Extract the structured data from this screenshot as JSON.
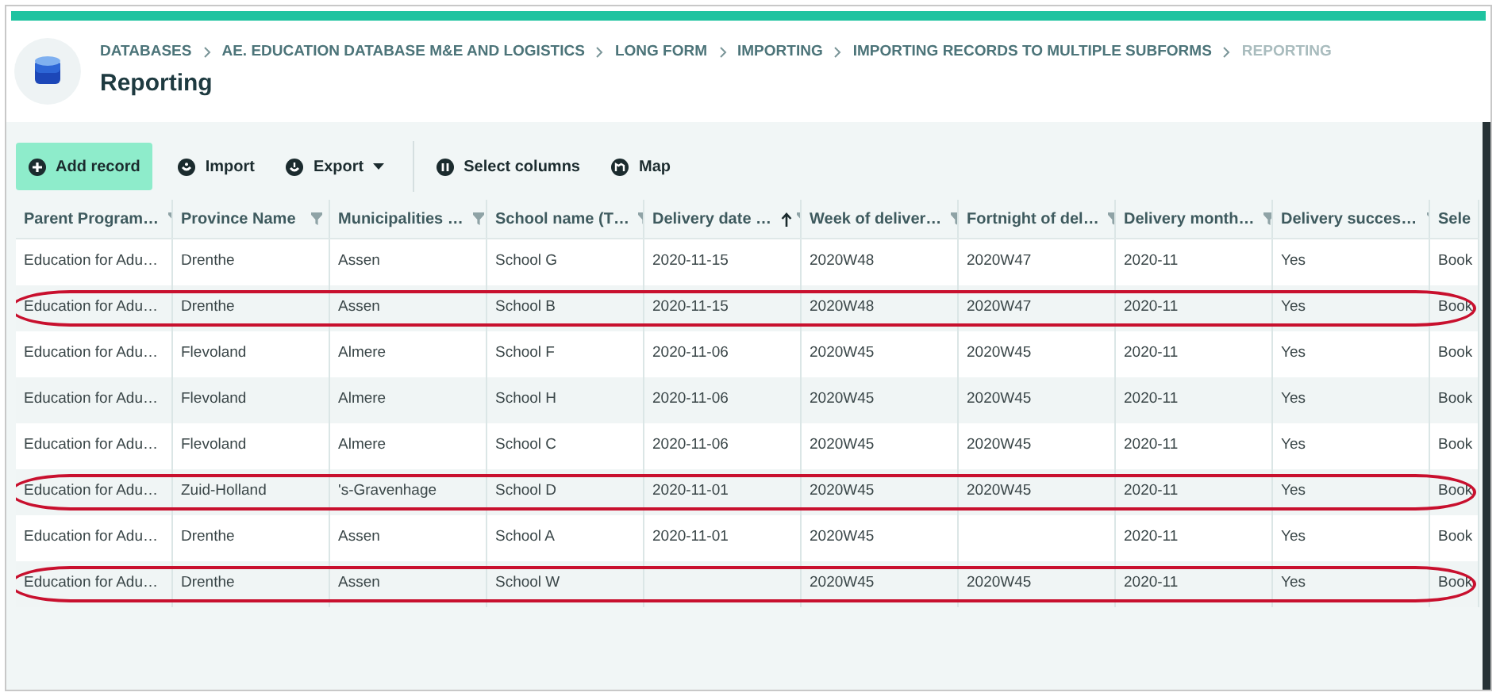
{
  "breadcrumbs": [
    {
      "label": "DATABASES",
      "current": false
    },
    {
      "label": "AE. EDUCATION DATABASE M&E AND LOGISTICS",
      "current": false
    },
    {
      "label": "LONG FORM",
      "current": false
    },
    {
      "label": "IMPORTING",
      "current": false
    },
    {
      "label": "IMPORTING RECORDS TO MULTIPLE SUBFORMS",
      "current": false
    },
    {
      "label": "REPORTING",
      "current": true
    }
  ],
  "title": "Reporting",
  "toolbar": [
    {
      "kind": "add",
      "label": "Add record",
      "primary": true,
      "dropdown": false
    },
    {
      "kind": "import",
      "label": "Import",
      "primary": false,
      "dropdown": false
    },
    {
      "kind": "export",
      "label": "Export",
      "primary": false,
      "dropdown": true
    },
    {
      "kind": "columns",
      "label": "Select columns",
      "primary": false,
      "dropdown": false
    },
    {
      "kind": "map",
      "label": "Map",
      "primary": false,
      "dropdown": false
    }
  ],
  "table": {
    "columns": [
      {
        "label": "Parent Program…",
        "sorted": false
      },
      {
        "label": "Province Name",
        "sorted": false
      },
      {
        "label": "Municipalities …",
        "sorted": false
      },
      {
        "label": "School name (T…",
        "sorted": false
      },
      {
        "label": "Delivery date …",
        "sorted": true
      },
      {
        "label": "Week of deliver…",
        "sorted": false
      },
      {
        "label": "Fortnight of del…",
        "sorted": false
      },
      {
        "label": "Delivery month…",
        "sorted": false
      },
      {
        "label": "Delivery succes…",
        "sorted": false
      },
      {
        "label": "Sele",
        "sorted": false
      }
    ],
    "rows": [
      {
        "highlighted": false,
        "cells": [
          "Education for Adu…",
          "Drenthe",
          "Assen",
          "School G",
          "2020-11-15",
          "2020W48",
          "2020W47",
          "2020-11",
          "Yes",
          "Book"
        ]
      },
      {
        "highlighted": true,
        "cells": [
          "Education for Adu…",
          "Drenthe",
          "Assen",
          "School B",
          "2020-11-15",
          "2020W48",
          "2020W47",
          "2020-11",
          "Yes",
          "Book"
        ]
      },
      {
        "highlighted": false,
        "cells": [
          "Education for Adu…",
          "Flevoland",
          "Almere",
          "School F",
          "2020-11-06",
          "2020W45",
          "2020W45",
          "2020-11",
          "Yes",
          "Book"
        ]
      },
      {
        "highlighted": false,
        "cells": [
          "Education for Adu…",
          "Flevoland",
          "Almere",
          "School H",
          "2020-11-06",
          "2020W45",
          "2020W45",
          "2020-11",
          "Yes",
          "Book"
        ]
      },
      {
        "highlighted": false,
        "cells": [
          "Education for Adu…",
          "Flevoland",
          "Almere",
          "School C",
          "2020-11-06",
          "2020W45",
          "2020W45",
          "2020-11",
          "Yes",
          "Book"
        ]
      },
      {
        "highlighted": true,
        "cells": [
          "Education for Adu…",
          "Zuid-Holland",
          "'s-Gravenhage",
          "School D",
          "2020-11-01",
          "2020W45",
          "2020W45",
          "2020-11",
          "Yes",
          "Book"
        ]
      },
      {
        "highlighted": false,
        "cells": [
          "Education for Adu…",
          "Drenthe",
          "Assen",
          "School A",
          "2020-11-01",
          "2020W45",
          "",
          "2020-11",
          "Yes",
          "Book"
        ]
      },
      {
        "highlighted": true,
        "cells": [
          "Education for Adu…",
          "Drenthe",
          "Assen",
          "School W",
          "",
          "2020W45",
          "2020W45",
          "2020-11",
          "Yes",
          "Book"
        ]
      }
    ]
  }
}
